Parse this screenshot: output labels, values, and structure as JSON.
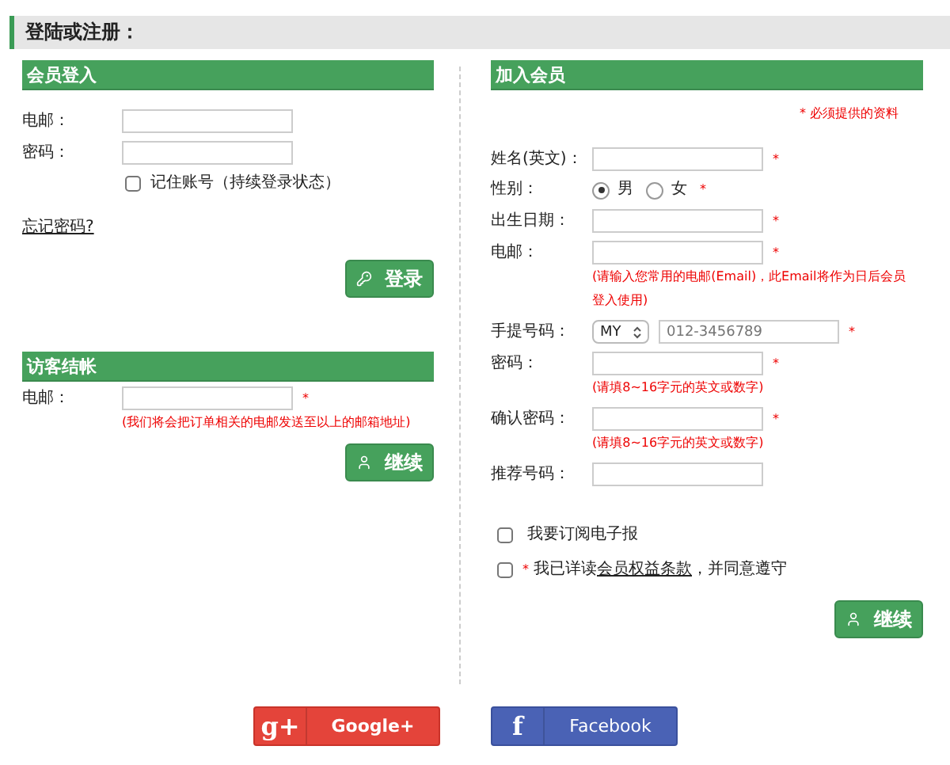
{
  "page_title": "登陆或注册：",
  "login": {
    "title": "会员登入",
    "fields": [
      {
        "label": "电邮："
      },
      {
        "label": "密码："
      }
    ],
    "remember": {
      "label": "记住账号（持续登录状态）",
      "checked": false
    },
    "forgot": "忘记密码?",
    "button": "登录"
  },
  "guest": {
    "title": "访客结帐",
    "fields": [
      {
        "label": "电邮：",
        "mark": "*",
        "note": "(我们将会把订单相关的电邮发送至以上的邮箱地址)"
      }
    ],
    "button": "继续"
  },
  "register": {
    "title": "加入会员",
    "required_note": "* 必须提供的资料",
    "fields": [
      {
        "kind": "text",
        "label": "姓名(英文)：",
        "mark": "*"
      },
      {
        "kind": "radio",
        "label": "性别：",
        "mark": "*",
        "options": [
          {
            "label": "男",
            "selected": true
          },
          {
            "label": "女",
            "selected": false
          }
        ]
      },
      {
        "kind": "text",
        "label": "出生日期：",
        "mark": "*"
      },
      {
        "kind": "text",
        "label": "电邮：",
        "mark": "*",
        "note": "(请输入您常用的电邮(Email)，此Email将作为日后会员登入使用)"
      },
      {
        "kind": "phone",
        "label": "手提号码：",
        "mark": "*",
        "country": "MY",
        "placeholder": "012-3456789"
      },
      {
        "kind": "text",
        "label": "密码：",
        "mark": "*",
        "note": "(请填8~16字元的英文或数字)"
      },
      {
        "kind": "text",
        "label": "确认密码：",
        "mark": "*",
        "note": "(请填8~16字元的英文或数字)"
      },
      {
        "kind": "text",
        "label": "推荐号码："
      }
    ],
    "subscribe": {
      "label": "我要订阅电子报",
      "checked": false
    },
    "agree": {
      "mark": "*",
      "before": "我已详读",
      "link": "会员权益条款",
      "after": "，并同意遵守",
      "checked": false
    },
    "button": "继续"
  },
  "social": [
    {
      "kind": "google",
      "glyph": "g+",
      "label": "Google+"
    },
    {
      "kind": "facebook",
      "glyph": "f",
      "label": "Facebook"
    }
  ]
}
